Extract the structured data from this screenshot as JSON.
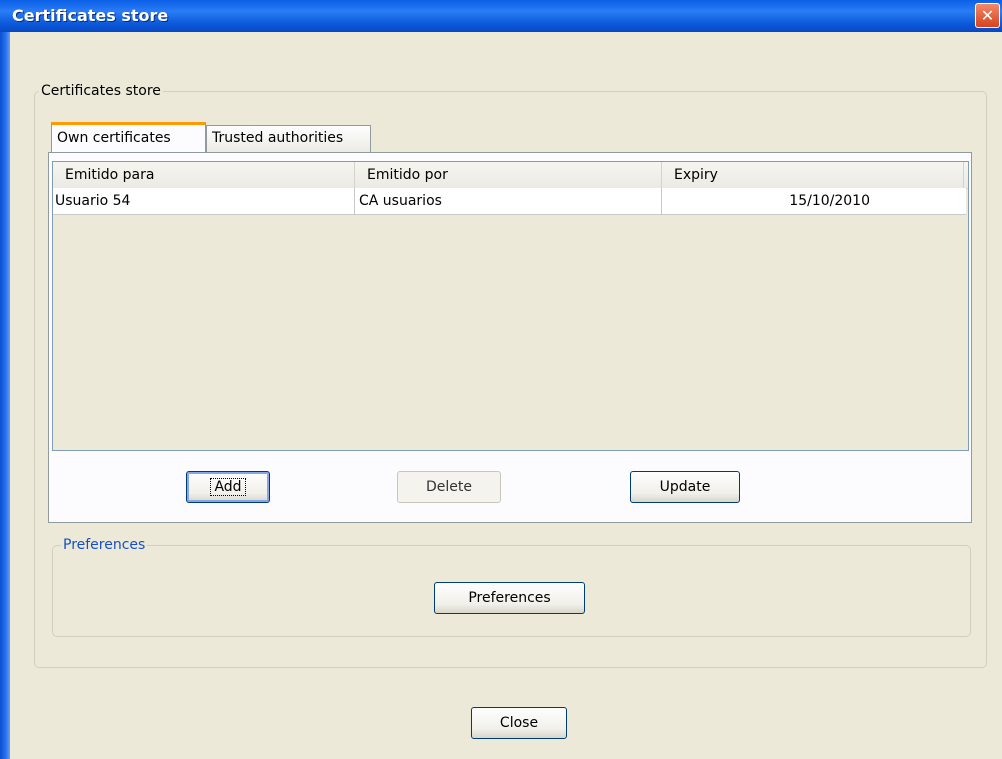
{
  "window": {
    "title": "Certificates store",
    "close_glyph": "✕"
  },
  "store_group": {
    "legend": "Certificates store"
  },
  "tabs": [
    {
      "label": "Own certificates",
      "active": true
    },
    {
      "label": "Trusted authorities",
      "active": false
    }
  ],
  "table": {
    "columns": [
      "Emitido para",
      "Emitido por",
      "Expiry"
    ],
    "rows": [
      {
        "emitido_para": "Usuario 54",
        "emitido_por": "CA usuarios",
        "expiry": "15/10/2010"
      }
    ]
  },
  "buttons": {
    "add": "Add",
    "delete": "Delete",
    "update": "Update",
    "preferences": "Preferences",
    "close": "Close"
  },
  "preferences_group": {
    "legend": "Preferences"
  },
  "colors": {
    "titlebar": "#0b58da",
    "tab_active_accent": "#ff9a00",
    "legend_blue": "#1650c8",
    "dialog_bg": "#ece9d8"
  }
}
